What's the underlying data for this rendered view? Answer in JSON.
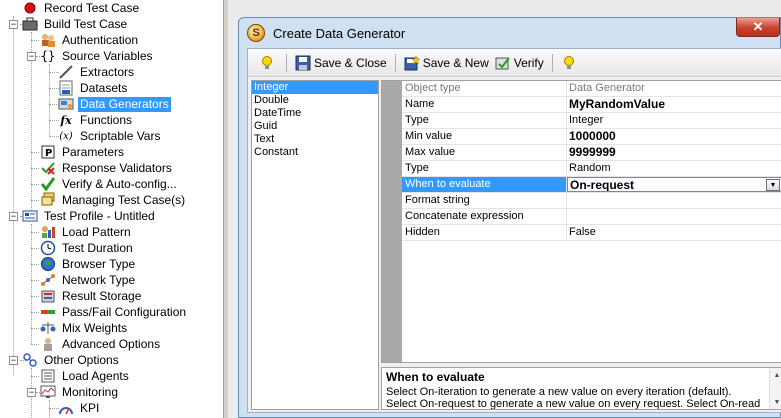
{
  "tree": {
    "items": [
      {
        "label": "Record Test Case",
        "icon": "record-icon"
      },
      {
        "label": "Build Test Case",
        "icon": "briefcase-icon"
      },
      {
        "label": "Authentication",
        "icon": "users-icon"
      },
      {
        "label": "Source Variables",
        "icon": "braces-icon"
      },
      {
        "label": "Extractors",
        "icon": "pen-icon"
      },
      {
        "label": "Datasets",
        "icon": "dataset-icon"
      },
      {
        "label": "Data Generators",
        "icon": "generator-icon"
      },
      {
        "label": "Functions",
        "icon": "function-icon"
      },
      {
        "label": "Scriptable Vars",
        "icon": "script-icon"
      },
      {
        "label": "Parameters",
        "icon": "parameter-icon"
      },
      {
        "label": "Response Validators",
        "icon": "validator-icon"
      },
      {
        "label": "Verify & Auto-config...",
        "icon": "checkmark-icon"
      },
      {
        "label": "Managing Test Case(s)",
        "icon": "stack-icon"
      },
      {
        "label": "Test Profile - Untitled",
        "icon": "profile-icon"
      },
      {
        "label": "Load Pattern",
        "icon": "chart-icon"
      },
      {
        "label": "Test Duration",
        "icon": "clock-icon"
      },
      {
        "label": "Browser Type",
        "icon": "globe-icon"
      },
      {
        "label": "Network Type",
        "icon": "network-icon"
      },
      {
        "label": "Result Storage",
        "icon": "storage-icon"
      },
      {
        "label": "Pass/Fail Configuration",
        "icon": "passfail-icon"
      },
      {
        "label": "Mix Weights",
        "icon": "weights-icon"
      },
      {
        "label": "Advanced Options",
        "icon": "options-icon"
      },
      {
        "label": "Other Options",
        "icon": "other-options-icon"
      },
      {
        "label": "Load Agents",
        "icon": "agents-icon"
      },
      {
        "label": "Monitoring",
        "icon": "monitoring-icon"
      },
      {
        "label": "KPI",
        "icon": "kpi-icon"
      }
    ]
  },
  "dialog": {
    "title": "Create Data Generator",
    "close_label": "✕",
    "app_icon_letter": "S"
  },
  "toolbar": {
    "save_close_label": "Save & Close",
    "save_new_label": "Save & New",
    "verify_label": "Verify"
  },
  "type_list": {
    "items": [
      "Integer",
      "Double",
      "DateTime",
      "Guid",
      "Text",
      "Constant"
    ],
    "selected": "Integer"
  },
  "grid": {
    "header": {
      "name": "Object type",
      "value": "Data Generator"
    },
    "rows": [
      {
        "name": "Name",
        "value": "MyRandomValue",
        "bold": true
      },
      {
        "name": "Type",
        "value": "Integer",
        "bold": false
      },
      {
        "name": "Min value",
        "value": "1000000",
        "bold": true
      },
      {
        "name": "Max value",
        "value": "9999999",
        "bold": true
      },
      {
        "name": "Type",
        "value": "Random",
        "bold": false
      },
      {
        "name": "When to evaluate",
        "value": "On-request",
        "bold": true
      },
      {
        "name": "Format string",
        "value": "",
        "bold": false
      },
      {
        "name": "Concatenate expression",
        "value": "",
        "bold": false
      },
      {
        "name": "Hidden",
        "value": "False",
        "bold": false
      }
    ]
  },
  "description": {
    "title": "When to evaluate",
    "text": "Select On-iteration to generate a new value on every iteration (default). Select On-request to generate a new value on every request. Select On-read to generate a new value for every recorded value being replaced."
  },
  "colors": {
    "selection": "#3399ff",
    "dialog_frame": "#cfe0f2",
    "close_button": "#c7412b"
  }
}
